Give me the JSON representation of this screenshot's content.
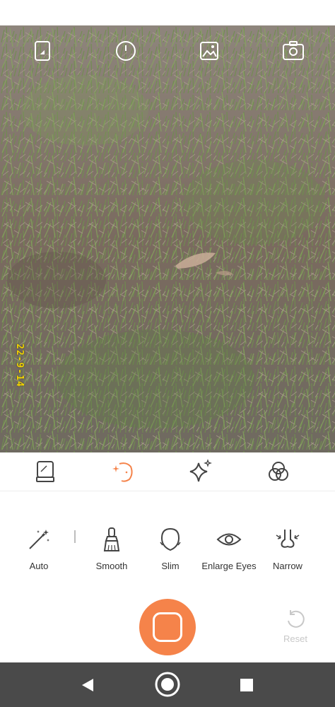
{
  "viewfinder": {
    "date_stamp": "22-9-14"
  },
  "top_bar": {
    "icons": [
      "aspect-ratio-icon",
      "timer-icon",
      "gallery-icon",
      "switch-camera-icon"
    ]
  },
  "mode_tabs": [
    {
      "name": "makeup-tab",
      "icon": "makeup-icon",
      "selected": false
    },
    {
      "name": "beauty-tab",
      "icon": "face-sparkle-icon",
      "selected": true
    },
    {
      "name": "effects-tab",
      "icon": "sparkle-icon",
      "selected": false
    },
    {
      "name": "filters-tab",
      "icon": "filter-circles-icon",
      "selected": false
    }
  ],
  "tools": [
    {
      "icon": "magic-wand-icon",
      "label": "Auto"
    },
    {
      "icon": "brush-icon",
      "label": "Smooth"
    },
    {
      "icon": "face-outline-icon",
      "label": "Slim"
    },
    {
      "icon": "eye-icon",
      "label": "Enlarge Eyes"
    },
    {
      "icon": "nose-icon",
      "label": "Narrow"
    }
  ],
  "shutter": {
    "color": "#f5834a"
  },
  "reset": {
    "label": "Reset",
    "enabled": false
  },
  "colors": {
    "accent": "#f5834a",
    "nav_bar": "#4a4a4a",
    "disabled_text": "#c8c8c8"
  }
}
